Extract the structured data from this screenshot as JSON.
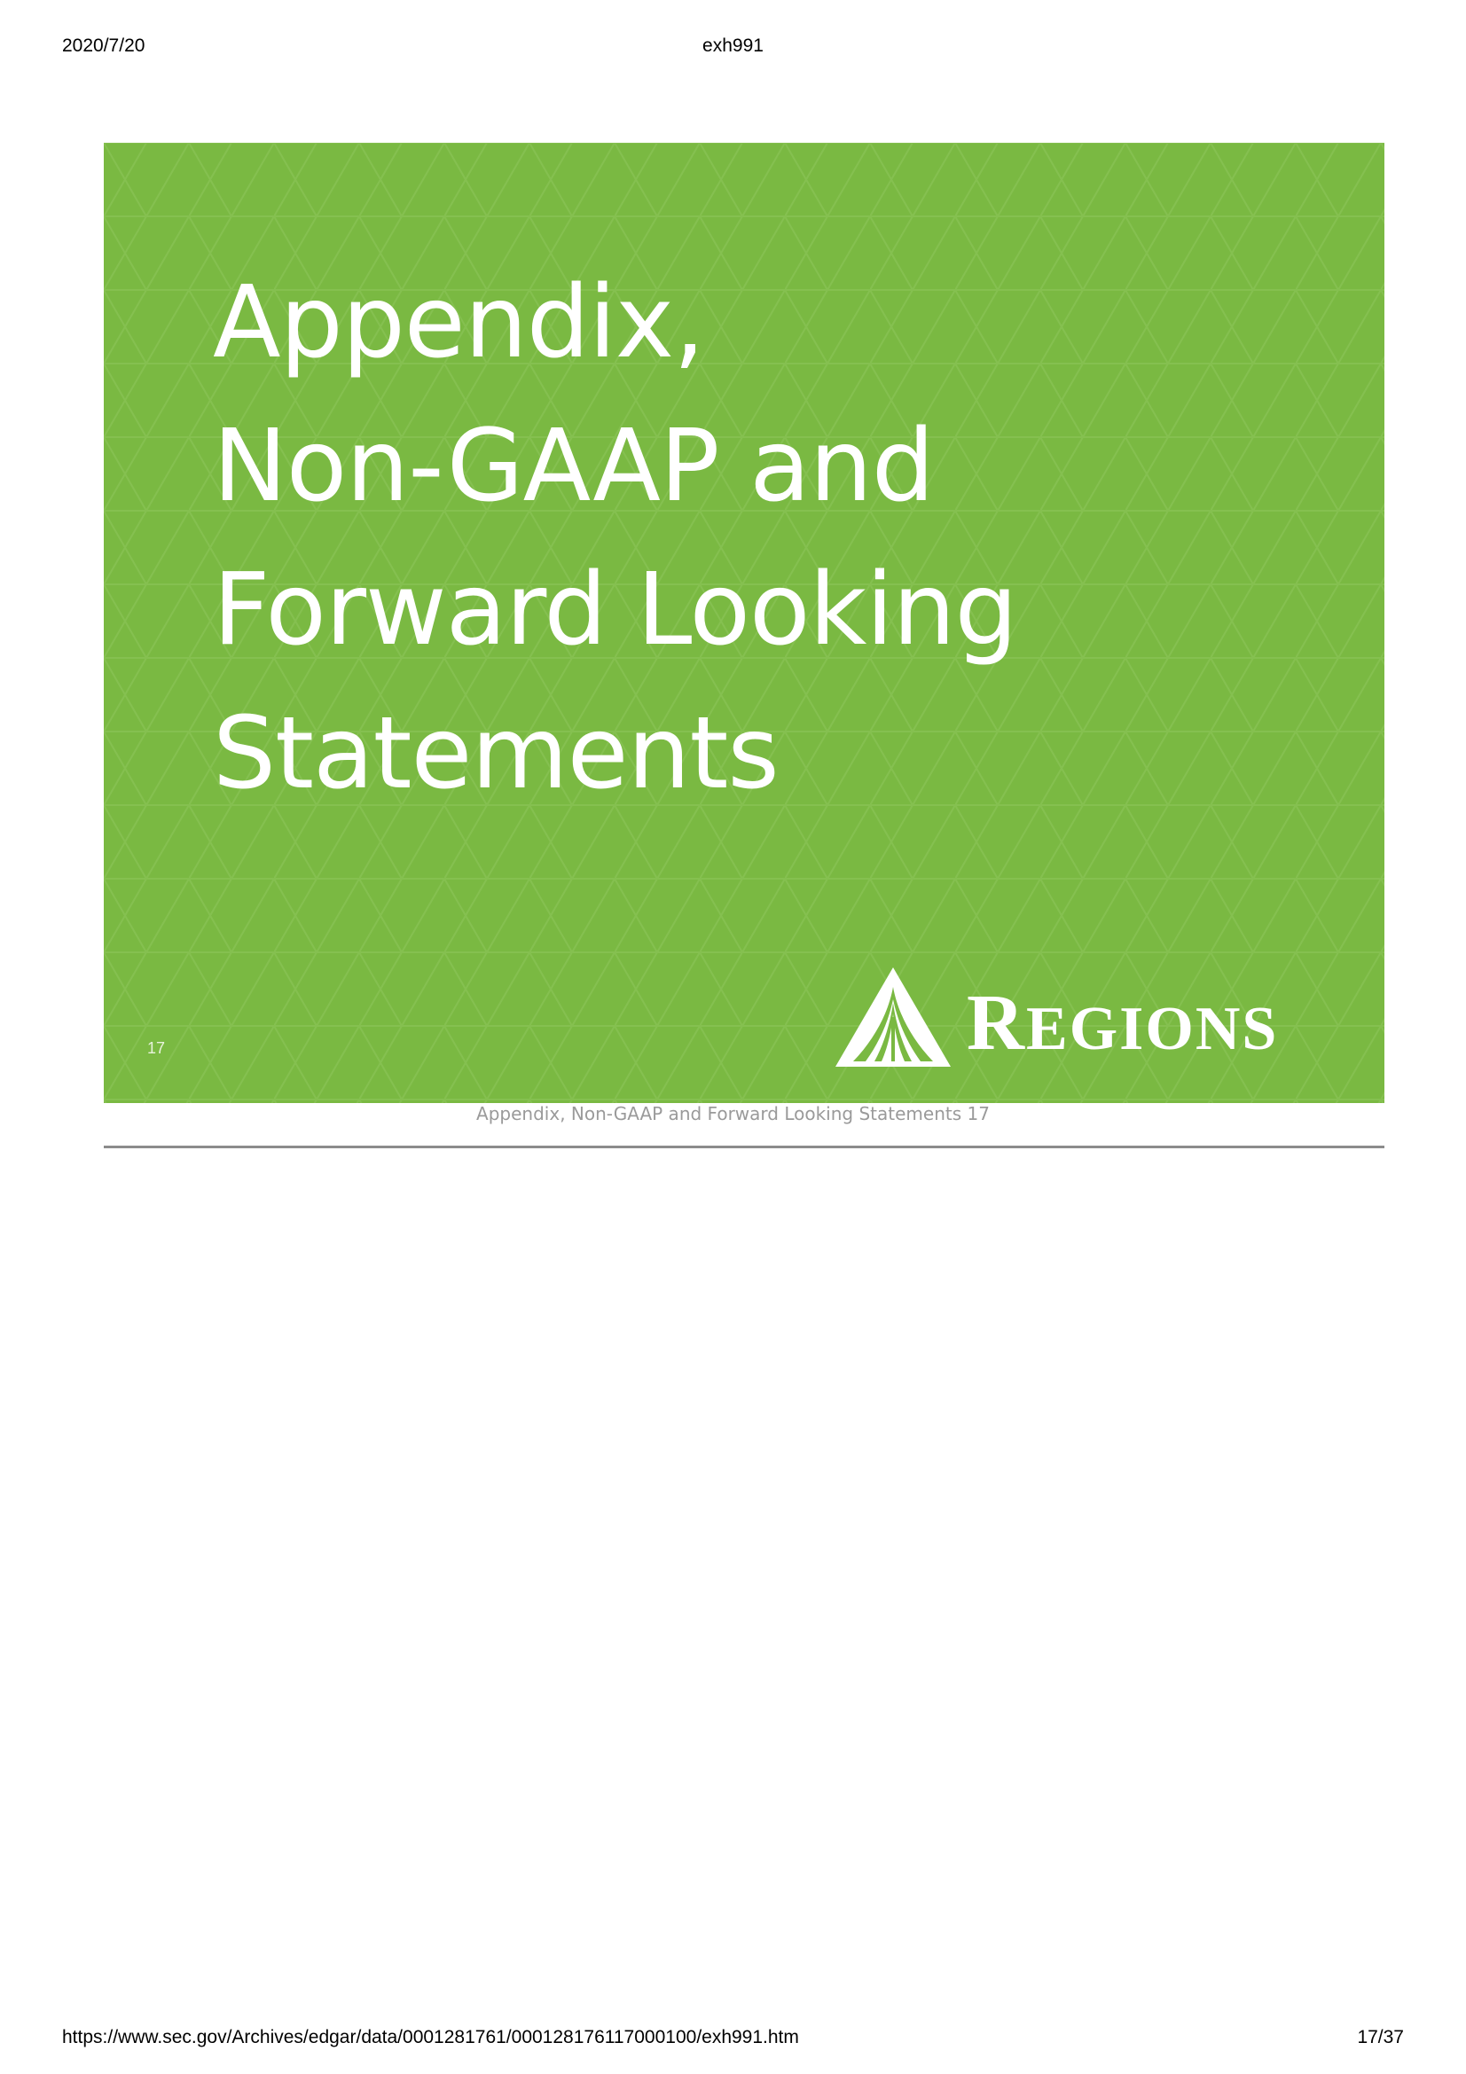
{
  "print_header": {
    "date": "2020/7/20",
    "doc_name": "exh991"
  },
  "slide": {
    "title_lines": [
      "Appendix,",
      "Non-GAAP and",
      "Forward Looking",
      "Statements"
    ],
    "page_number": "17",
    "background_color": "#7ab942",
    "logo": {
      "mark_icon": "regions-pyramid-logo-icon",
      "text_initial": "R",
      "text_rest": "EGIONS"
    }
  },
  "caption": "Appendix, Non-GAAP and Forward Looking Statements 17",
  "print_footer": {
    "url": "https://www.sec.gov/Archives/edgar/data/0001281761/000128176117000100/exh991.htm",
    "page": "17/37"
  }
}
